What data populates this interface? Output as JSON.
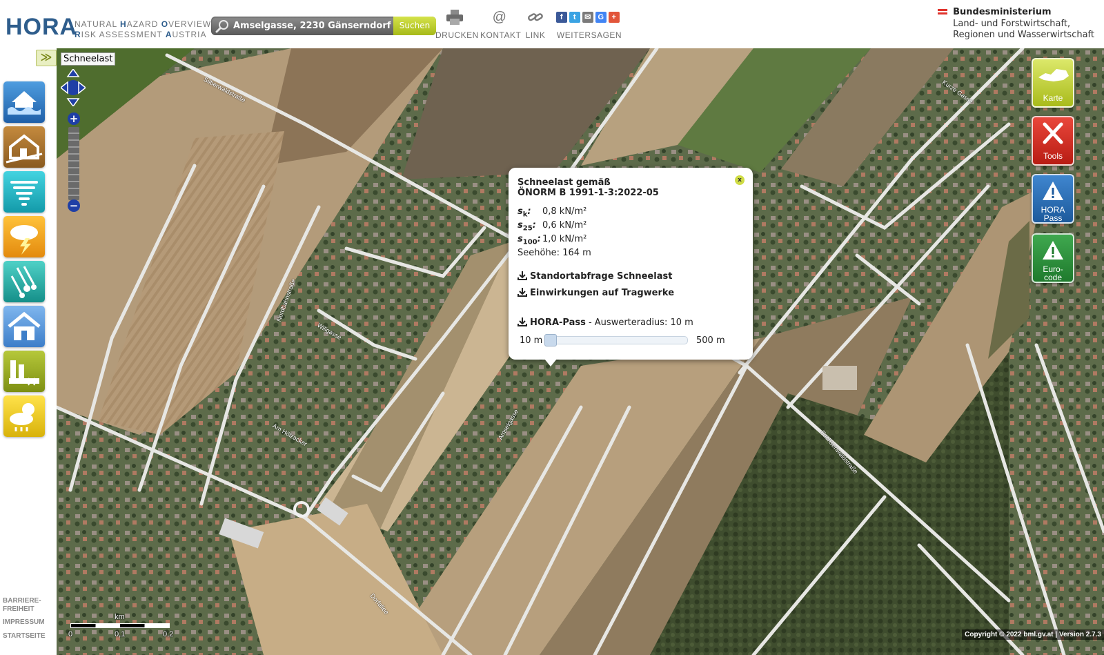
{
  "header": {
    "logo": "HORA",
    "logo_sub_line1": [
      "N",
      "ATURAL ",
      "H",
      "AZARD ",
      "O",
      "VERVIEW &"
    ],
    "logo_sub_line2": [
      "R",
      "ISK ASSESSMENT ",
      "A",
      "USTRIA"
    ],
    "search": {
      "value": "Amselgasse, 2230 Gänserndorf",
      "button_label": "Suchen"
    },
    "tools": {
      "print": "DRUCKEN",
      "contact": "KONTAKT",
      "link": "LINK",
      "share": "WEITERSAGEN"
    },
    "social": {
      "facebook": "f",
      "twitter": "t",
      "mail": "✉",
      "google": "G",
      "plus": "+"
    },
    "ministry": {
      "line1": "Bundesministerium",
      "line2": "Land- und Forstwirtschaft,",
      "line3": "Regionen und Wasserwirtschaft"
    }
  },
  "sidebar": {
    "hazards": [
      "flood-icon",
      "mass-movement-icon",
      "storm-icon",
      "thunderstorm-icon",
      "hail-icon",
      "snow-load-icon",
      "industry-icon",
      "weather-icon"
    ],
    "footer": {
      "barrier_free_1": "BARRIERE-",
      "barrier_free_2": "FREIHEIT",
      "imprint": "IMPRESSUM",
      "home": "STARTSEITE"
    }
  },
  "map": {
    "expand": "≫",
    "layer_label": "Schneelast",
    "zoom_in": "+",
    "zoom_out": "−",
    "scale_unit": "km",
    "scale_ticks": [
      "0",
      "0,1",
      "0,2"
    ],
    "copyright": "Copyright © 2022 bml.gv.at | Version 2.7.3",
    "streets": [
      "Silberwaldstraße",
      "Leopold-Ullrich-Gasse",
      "Nordbahnstraße",
      "Wiligasse",
      "Am Hölzacker",
      "Amselgasse",
      "Fuchsenweg",
      "Fuchsenwaldstraße",
      "Bahnhofstraße",
      "Obere Gasse",
      "Kurze Gasse",
      "Dorfallee"
    ]
  },
  "right_panel": {
    "map_btn": "Karte",
    "tools_btn": "Tools",
    "hora_pass_1": "HORA",
    "hora_pass_2": "Pass",
    "eurocode_1": "Euro-",
    "eurocode_2": "code"
  },
  "popup": {
    "close": "x",
    "title_1": "Schneelast gemäß",
    "title_2": "ÖNORM B 1991-1-3:2022-05",
    "values": [
      {
        "symbol": "s",
        "sub": "k",
        "value": "0,8 kN/m²"
      },
      {
        "symbol": "s",
        "sub": "25",
        "value": "0,6 kN/m²"
      },
      {
        "symbol": "s",
        "sub": "100",
        "value": "1,0 kN/m²"
      }
    ],
    "altitude": "Seehöhe: 164 m",
    "link_1": "Standortabfrage Schneelast",
    "link_2": "Einwirkungen auf Tragwerke",
    "hora_pass_label": "HORA-Pass",
    "radius_text": " - Auswerteradius: 10 m",
    "slider_min": "10 m",
    "slider_max": "500 m",
    "slider_value_fraction": 0
  },
  "colors": {
    "brand_blue": "#2e5d8c",
    "accent_green": "#b5c62a",
    "tools_red": "#d42d22",
    "pass_blue": "#2a6fb5",
    "eurocode_green": "#2e8a3c"
  }
}
